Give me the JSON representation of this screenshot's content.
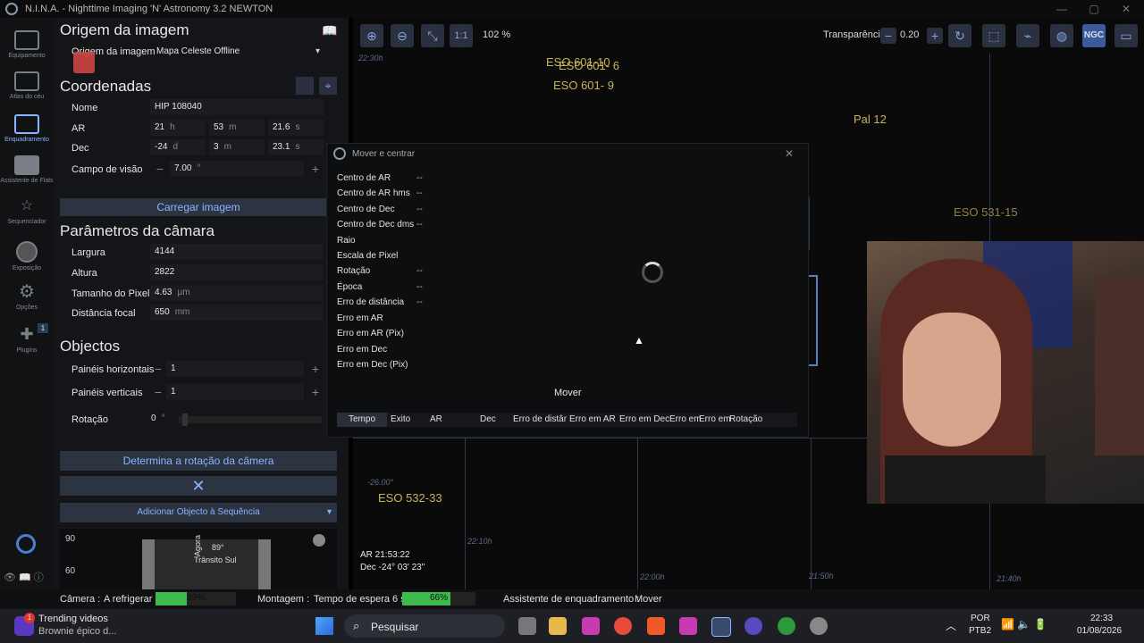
{
  "window": {
    "title": "N.I.N.A. - Nighttime Imaging 'N' Astronomy 3.2    NEWTON"
  },
  "nav": [
    {
      "label": "Equipamento"
    },
    {
      "label": "Atlas do céu"
    },
    {
      "label": "Enquadramento"
    },
    {
      "label": "Assistente de Flats"
    },
    {
      "label": "Sequenciador"
    },
    {
      "label": "Exposição"
    },
    {
      "label": "Opções"
    },
    {
      "label": "Plugins",
      "badge": "1"
    }
  ],
  "panel": {
    "image_source_title": "Origem da imagem",
    "image_source_label": "Origem da imagem",
    "image_source_value": "Mapa Celeste Offline",
    "coords_title": "Coordenadas",
    "name_label": "Nome",
    "name_value": "HIP 108040",
    "ra_label": "AR",
    "ra_h": "21",
    "ra_h_unit": "h",
    "ra_m": "53",
    "ra_m_unit": "m",
    "ra_s": "21.6",
    "ra_s_unit": "s",
    "dec_label": "Dec",
    "dec_d": "-24",
    "dec_d_unit": "d",
    "dec_m": "3",
    "dec_m_unit": "m",
    "dec_s": "23.1",
    "dec_s_unit": "s",
    "fov_label": "Campo de visão",
    "fov_value": "7.00",
    "fov_unit": "°",
    "load_image": "Carregar imagem",
    "camera_title": "Parâmetros da câmara",
    "width_label": "Largura",
    "width_value": "4144",
    "height_label": "Altura",
    "height_value": "2822",
    "pixel_label": "Tamanho do Pixel",
    "pixel_value": "4.63",
    "pixel_unit": "µm",
    "focal_label": "Distância focal",
    "focal_value": "650",
    "focal_unit": "mm",
    "objects_title": "Objectos",
    "hpanels_label": "Painéis horizontais",
    "hpanels_value": "1",
    "vpanels_label": "Painéis verticais",
    "vpanels_value": "1",
    "rotation_label": "Rotação",
    "rotation_value": "0",
    "rotation_unit": "°",
    "determine_rotation": "Determina a rotação da câmera",
    "add_to_sequence": "Adicionar Objecto à Sequência",
    "alt_chart": {
      "y90": "90",
      "y60": "60",
      "now_label": "Agora",
      "transit_label": "Trânsito Sul",
      "transit_alt": "89°"
    }
  },
  "toolbar": {
    "zoom_in": "zoom-in-icon",
    "zoom_out": "zoom-out-icon",
    "fit": "fit-icon",
    "one_to_one": "1:1",
    "zoom_level": "102 %",
    "transparency_label": "Transparência",
    "transparency_value": "0.20",
    "ngc": "NGC"
  },
  "sky": {
    "objects": [
      "ESO 601-10",
      "ESO 601- 6",
      "ESO 601- 9",
      "Pal 12",
      "ESO 531-15",
      "ESO 532-33"
    ],
    "coord_labels": [
      "22:30h",
      "-26.00°",
      "22:10h",
      "22:00h",
      "21:50h",
      "21:40h"
    ],
    "ra_readout": "AR 21:53:22",
    "dec_readout": "Dec -24° 03' 23\""
  },
  "dialog": {
    "title": "Mover e centrar",
    "rows": [
      {
        "label": "Centro de AR",
        "value": "--"
      },
      {
        "label": "Centro de AR hms",
        "value": "--"
      },
      {
        "label": "Centro de Dec",
        "value": "--"
      },
      {
        "label": "Centro de Dec dms",
        "value": "--"
      },
      {
        "label": "Raio",
        "value": ""
      },
      {
        "label": "Escala de Pixel",
        "value": ""
      },
      {
        "label": "Rotação",
        "value": "--"
      },
      {
        "label": "Época",
        "value": "--"
      },
      {
        "label": "Erro de distância",
        "value": "--"
      },
      {
        "label": "Erro em AR",
        "value": ""
      },
      {
        "label": "Erro em AR (Pix)",
        "value": ""
      },
      {
        "label": "Erro em Dec",
        "value": ""
      },
      {
        "label": "Erro em Dec (Pix)",
        "value": ""
      }
    ],
    "move_button": "Mover",
    "columns": [
      "Tempo",
      "Exito",
      "AR",
      "Dec",
      "Erro de distâr",
      "Erro em AR",
      "Erro em Dec",
      "Erro em",
      "Erro em",
      "Rotação"
    ]
  },
  "status": {
    "camera_label": "Câmera :",
    "camera_state": "A refrigerar",
    "camera_progress": 39,
    "camera_progress_text": "39%",
    "mount_label": "Montagem :",
    "mount_state": "Tempo de espera 6 s",
    "mount_progress": 66,
    "mount_progress_text": "66%",
    "framing_label": "Assistente de enquadramento :",
    "framing_state": "Mover"
  },
  "taskbar": {
    "notification_title": "Trending videos",
    "notification_sub": "Brownie épico d...",
    "notification_badge": "1",
    "search_placeholder": "Pesquisar",
    "lang1": "POR",
    "lang2": "PTB2",
    "time": "22:33",
    "date": "01/08/2026"
  },
  "colors": {
    "accent": "#8ab4ff",
    "progress": "#3cba4c",
    "object": "#c8b35a"
  }
}
